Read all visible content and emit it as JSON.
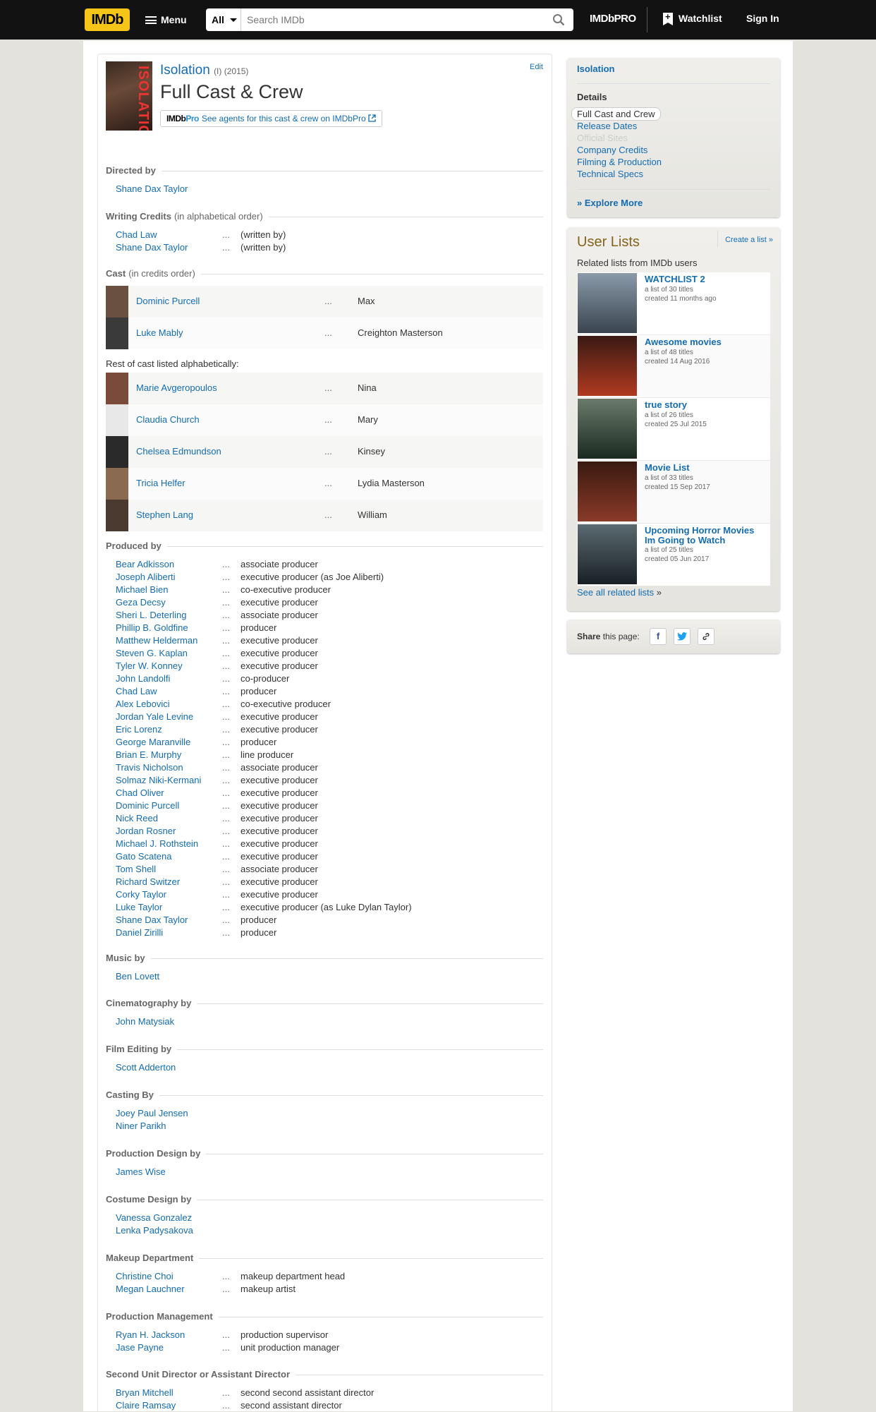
{
  "topbar": {
    "logo": "IMDb",
    "menu": "Menu",
    "search_cat": "All",
    "search_placeholder": "Search IMDb",
    "imdbpro": "IMDbPRO",
    "watchlist": "Watchlist",
    "signin": "Sign In"
  },
  "title": {
    "poster_text": "ISOLATION",
    "name": "Isolation",
    "year": "(I) (2015)",
    "page_title": "Full Cast & Crew",
    "edit": "Edit",
    "pro_logo_a": "IMDb",
    "pro_logo_b": "Pro",
    "pro_text": "See agents for this cast & crew on IMDbPro"
  },
  "directed": {
    "head": "Directed by",
    "names": [
      "Shane Dax Taylor"
    ]
  },
  "writing": {
    "head": "Writing Credits",
    "sub": "(in alphabetical order)",
    "rows": [
      [
        "Chad Law",
        "(written by)"
      ],
      [
        "Shane Dax Taylor",
        "(written by)"
      ]
    ]
  },
  "cast": {
    "head": "Cast",
    "sub": "(in credits order)",
    "rows": [
      [
        "Dominic Purcell",
        "Max"
      ],
      [
        "Luke Mably",
        "Creighton Masterson"
      ]
    ],
    "rest_label": "Rest of cast listed alphabetically:",
    "rest": [
      [
        "Marie Avgeropoulos",
        "Nina"
      ],
      [
        "Claudia Church",
        "Mary"
      ],
      [
        "Chelsea Edmundson",
        "Kinsey"
      ],
      [
        "Tricia Helfer",
        "Lydia Masterson"
      ],
      [
        "Stephen Lang",
        "William"
      ]
    ]
  },
  "produced": {
    "head": "Produced by",
    "rows": [
      [
        "Bear Adkisson",
        "associate producer"
      ],
      [
        "Joseph Aliberti",
        "executive producer (as Joe Aliberti)"
      ],
      [
        "Michael Bien",
        "co-executive producer"
      ],
      [
        "Geza Decsy",
        "executive producer"
      ],
      [
        "Sheri L. Deterling",
        "associate producer"
      ],
      [
        "Phillip B. Goldfine",
        "producer"
      ],
      [
        "Matthew Helderman",
        "executive producer"
      ],
      [
        "Steven G. Kaplan",
        "executive producer"
      ],
      [
        "Tyler W. Konney",
        "executive producer"
      ],
      [
        "John Landolfi",
        "co-producer"
      ],
      [
        "Chad Law",
        "producer"
      ],
      [
        "Alex Lebovici",
        "co-executive producer"
      ],
      [
        "Jordan Yale Levine",
        "executive producer"
      ],
      [
        "Eric Lorenz",
        "executive producer"
      ],
      [
        "George Maranville",
        "producer"
      ],
      [
        "Brian E. Murphy",
        "line producer"
      ],
      [
        "Travis Nicholson",
        "associate producer"
      ],
      [
        "Solmaz Niki-Kermani",
        "executive producer"
      ],
      [
        "Chad Oliver",
        "executive producer"
      ],
      [
        "Dominic Purcell",
        "executive producer"
      ],
      [
        "Nick Reed",
        "executive producer"
      ],
      [
        "Jordan Rosner",
        "executive producer"
      ],
      [
        "Michael J. Rothstein",
        "executive producer"
      ],
      [
        "Gato Scatena",
        "executive producer"
      ],
      [
        "Tom Shell",
        "associate producer"
      ],
      [
        "Richard Switzer",
        "executive producer"
      ],
      [
        "Corky Taylor",
        "executive producer"
      ],
      [
        "Luke Taylor",
        "executive producer (as Luke Dylan Taylor)"
      ],
      [
        "Shane Dax Taylor",
        "producer"
      ],
      [
        "Daniel Zirilli",
        "producer"
      ]
    ]
  },
  "music": {
    "head": "Music by",
    "names": [
      "Ben Lovett"
    ]
  },
  "cinema": {
    "head": "Cinematography by",
    "names": [
      "John Matysiak"
    ]
  },
  "editing": {
    "head": "Film Editing by",
    "names": [
      "Scott Adderton"
    ]
  },
  "casting": {
    "head": "Casting By",
    "names": [
      "Joey Paul Jensen",
      "Niner Parikh"
    ]
  },
  "proddesign": {
    "head": "Production Design by",
    "names": [
      "James Wise"
    ]
  },
  "costume": {
    "head": "Costume Design by",
    "names": [
      "Vanessa Gonzalez",
      "Lenka Padysakova"
    ]
  },
  "makeup": {
    "head": "Makeup Department",
    "rows": [
      [
        "Christine Choi",
        "makeup department head"
      ],
      [
        "Megan Lauchner",
        "makeup artist"
      ]
    ]
  },
  "prodmgmt": {
    "head": "Production Management",
    "rows": [
      [
        "Ryan H. Jackson",
        "production supervisor"
      ],
      [
        "Jase Payne",
        "unit production manager"
      ]
    ]
  },
  "second": {
    "head": "Second Unit Director or Assistant Director",
    "rows": [
      [
        "Bryan Mitchell",
        "second second assistant director"
      ],
      [
        "Claire Ramsay",
        "second assistant director"
      ]
    ]
  },
  "dots": "...",
  "side_nav": {
    "title": "Isolation",
    "details": "Details",
    "links": [
      "Full Cast and Crew",
      "Release Dates",
      "Official Sites",
      "Company Credits",
      "Filming & Production",
      "Technical Specs"
    ],
    "explore": "Explore More"
  },
  "user_lists": {
    "title": "User Lists",
    "create": "Create a list",
    "create_arrow": "»",
    "sub": "Related lists from IMDb users",
    "items": [
      {
        "title": "WATCHLIST 2",
        "count": "a list of 30 titles",
        "created": "created 11 months ago"
      },
      {
        "title": "Awesome movies",
        "count": "a list of 48 titles",
        "created": "created 14 Aug 2016"
      },
      {
        "title": "true story",
        "count": "a list of 26 titles",
        "created": "created 25 Jul 2015"
      },
      {
        "title": "Movie List",
        "count": "a list of 33 titles",
        "created": "created 15 Sep 2017"
      },
      {
        "title": "Upcoming Horror Movies Im Going to Watch",
        "count": "a list of 25 titles",
        "created": "created 05 Jun 2017"
      }
    ],
    "see_all": "See all related lists",
    "see_all_arrow": "»"
  },
  "share": {
    "bold": "Share",
    "rest": "this page:"
  },
  "colors": {
    "link": "#136cb2",
    "imdb_yellow": "#f5c518",
    "topbar": "#121212",
    "userlists_title": "#85631a"
  }
}
